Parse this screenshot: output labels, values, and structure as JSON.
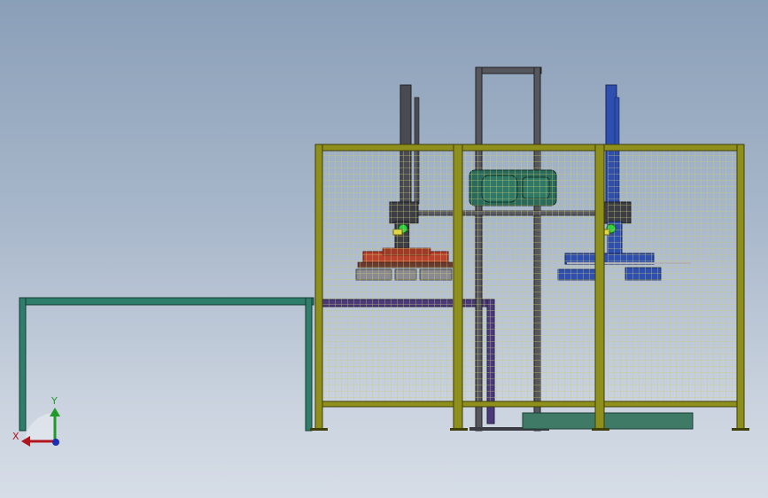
{
  "viewport": {
    "title": "",
    "background_top": "#8a9fb8",
    "background_bottom": "#d6dde7"
  },
  "triad": {
    "x_label": "X",
    "y_label": "Y",
    "x_color": "#b0141c",
    "y_color": "#1f9a2a",
    "z_color": "#1b2fb0"
  },
  "model": {
    "fence_color": "#8f8f1c",
    "mesh_color": "#cfd07a",
    "conveyor_color": "#2f7d6b",
    "robot_left_color": "#b8422e",
    "robot_right_color": "#2f4fb0",
    "column_color": "#4a4a52",
    "motor_color": "#2a6a5a",
    "pipe_color": "#4b3a7a"
  }
}
